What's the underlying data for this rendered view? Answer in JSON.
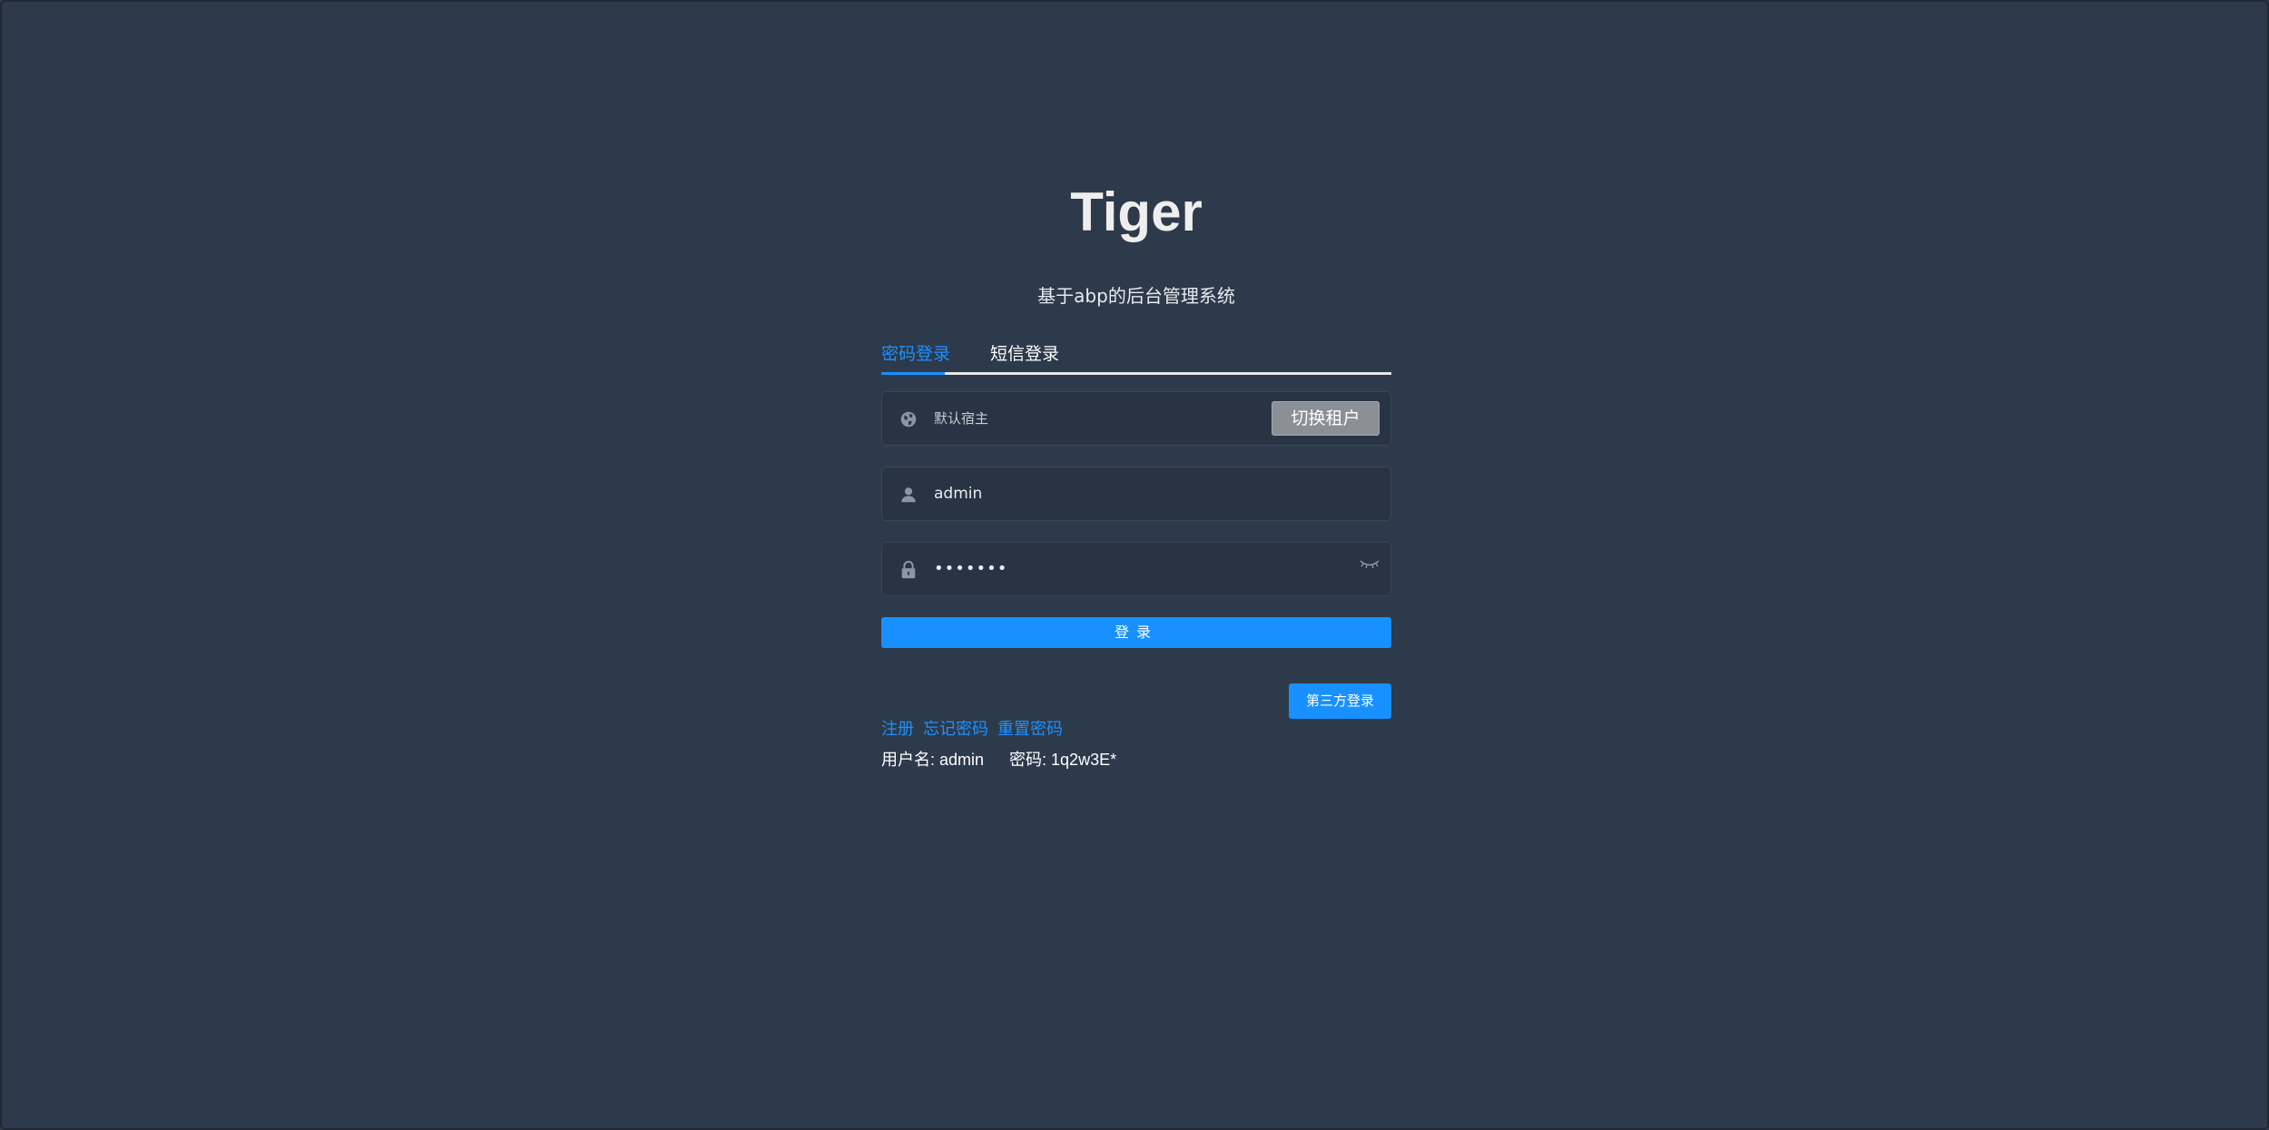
{
  "app": {
    "title": "Tiger",
    "subtitle": "基于abp的后台管理系统"
  },
  "tabs": [
    {
      "label": "密码登录",
      "active": true
    },
    {
      "label": "短信登录",
      "active": false
    }
  ],
  "tenant": {
    "value": "默认宿主",
    "icon": "globe-icon",
    "switch_label": "切换租户"
  },
  "username": {
    "value": "admin",
    "icon": "user-icon"
  },
  "password": {
    "value": "•••••••",
    "icon": "lock-icon",
    "toggle_icon": "eye-closed-icon"
  },
  "actions": {
    "login_label": "登录",
    "third_party_label": "第三方登录"
  },
  "links": {
    "register": "注册",
    "forgot_password": "忘记密码",
    "reset_password": "重置密码"
  },
  "hint": {
    "username": "用户名: admin",
    "password": "密码: 1q2w3E*"
  },
  "colors": {
    "background": "#2d3a4b",
    "accent": "#1890ff",
    "input_background": "#283443",
    "switch_button": "#8a9096"
  }
}
